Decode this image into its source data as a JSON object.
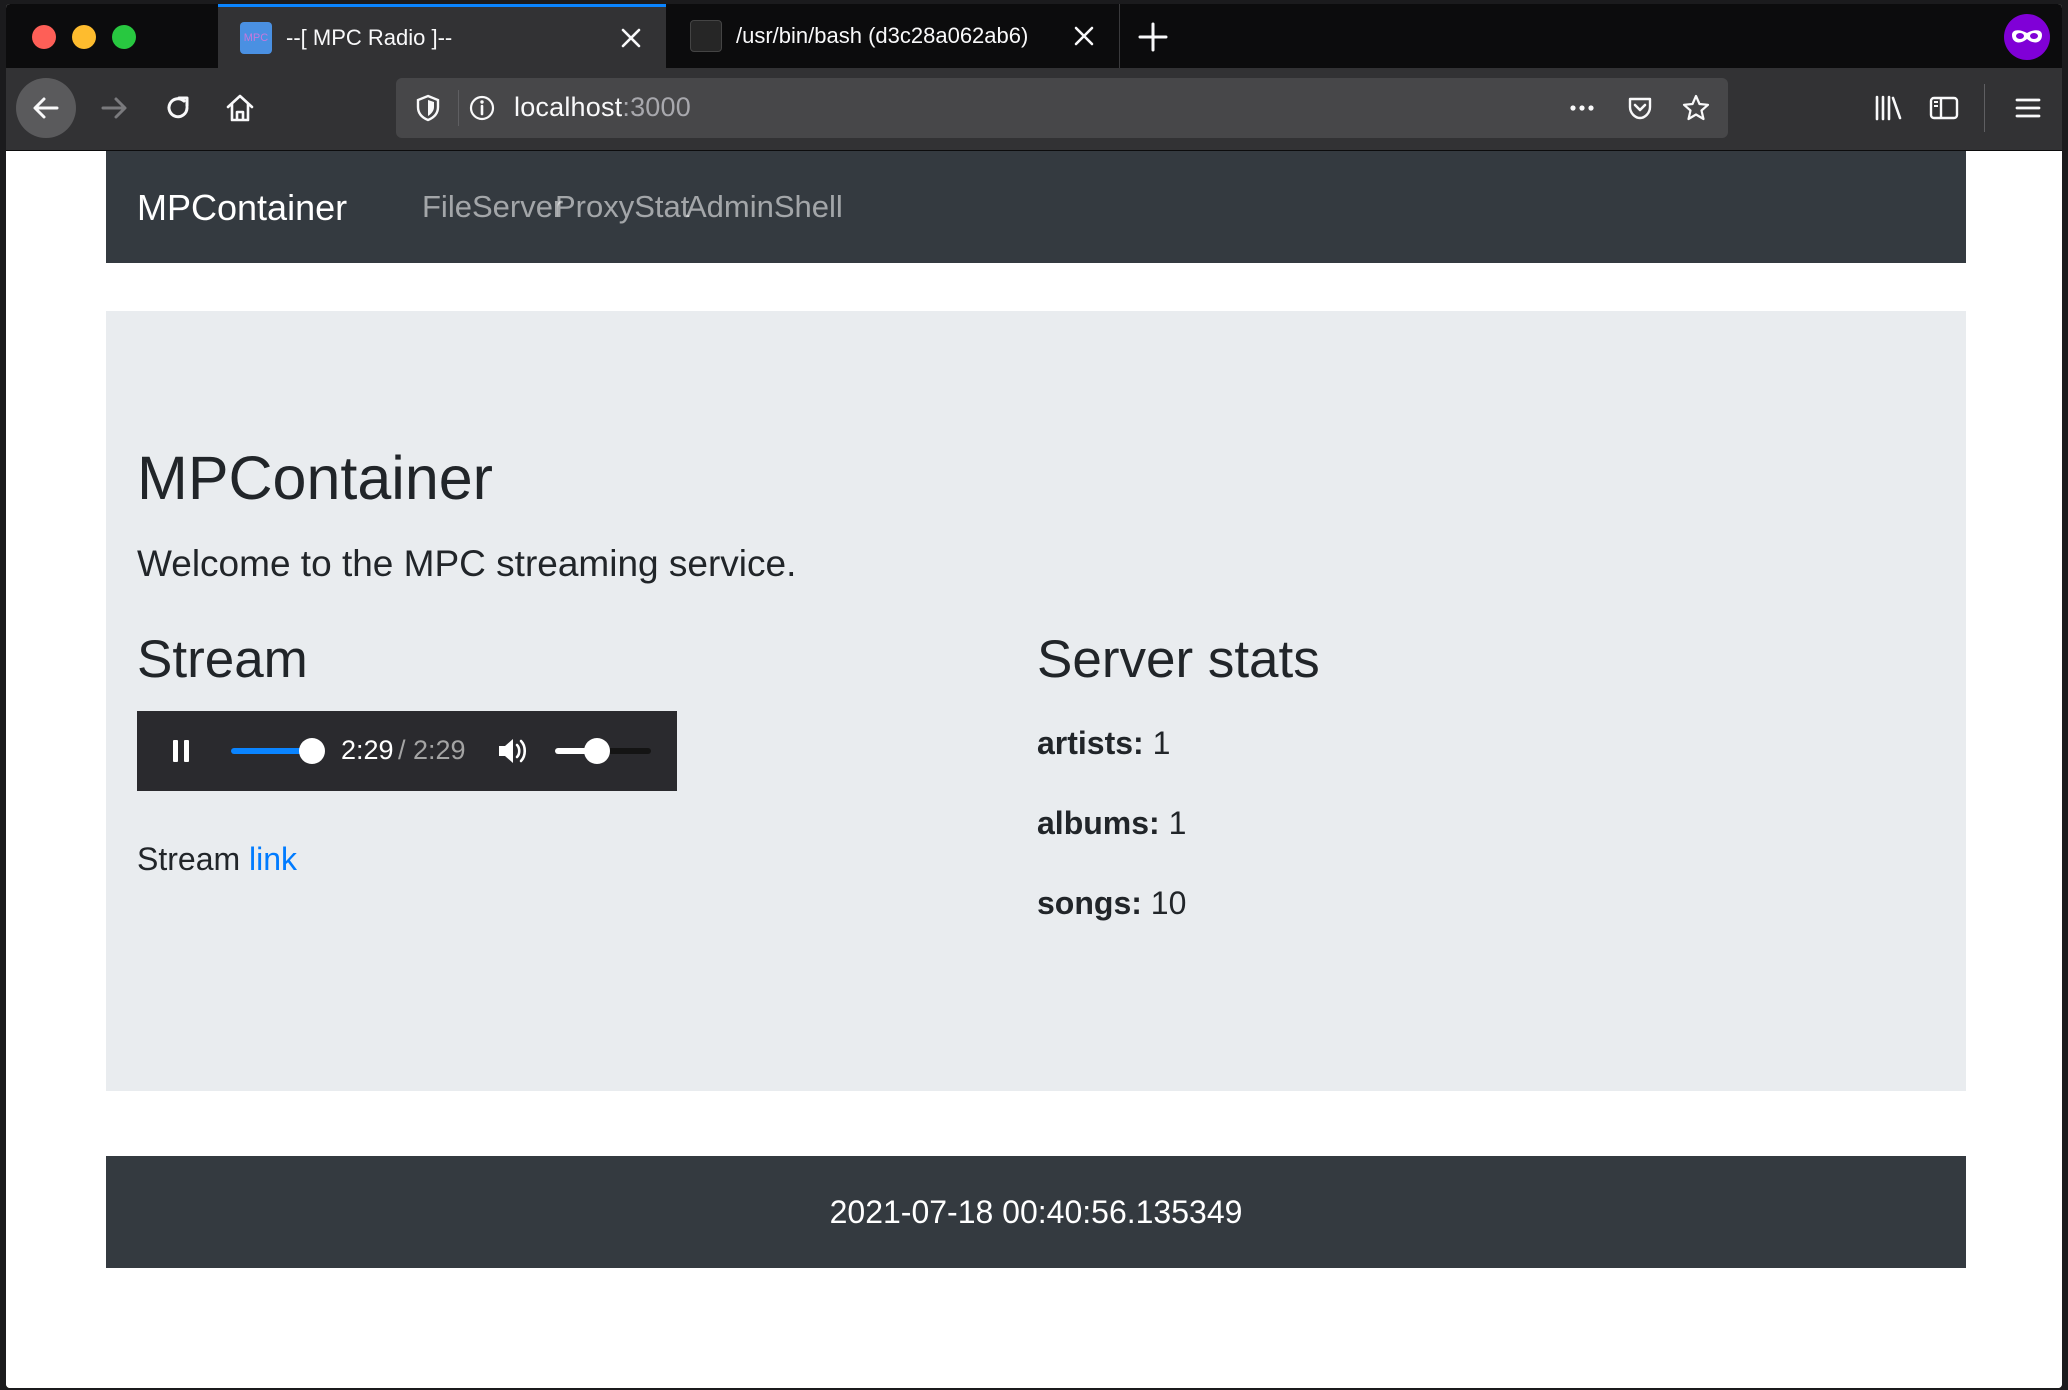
{
  "browser": {
    "tabs": [
      {
        "title": "--[ MPC Radio ]--",
        "favicon_text": "MPC",
        "active": true
      },
      {
        "title": "/usr/bin/bash (d3c28a062ab6)",
        "active": false
      }
    ],
    "url": {
      "host": "localhost",
      "port": ":3000"
    },
    "colors": {
      "tab_accent": "#0a84ff",
      "private_badge": "#8000d7"
    }
  },
  "site": {
    "brand": "MPContainer",
    "nav_links": [
      "FileServer",
      "ProxyStat",
      "AdminShell"
    ]
  },
  "jumbotron": {
    "title": "MPContainer",
    "lead": "Welcome to the MPC streaming service."
  },
  "stream": {
    "heading": "Stream",
    "player": {
      "time_current": "2:29",
      "time_total": "/ 2:29",
      "progress_fraction": 1.0,
      "volume_fraction": 0.4
    },
    "link_prefix": "Stream",
    "link_text": "link"
  },
  "stats": {
    "heading": "Server stats",
    "items": [
      {
        "label": "artists:",
        "value": "1"
      },
      {
        "label": "albums:",
        "value": "1"
      },
      {
        "label": "songs:",
        "value": "10"
      }
    ]
  },
  "footer": {
    "timestamp": "2021-07-18 00:40:56.135349"
  }
}
